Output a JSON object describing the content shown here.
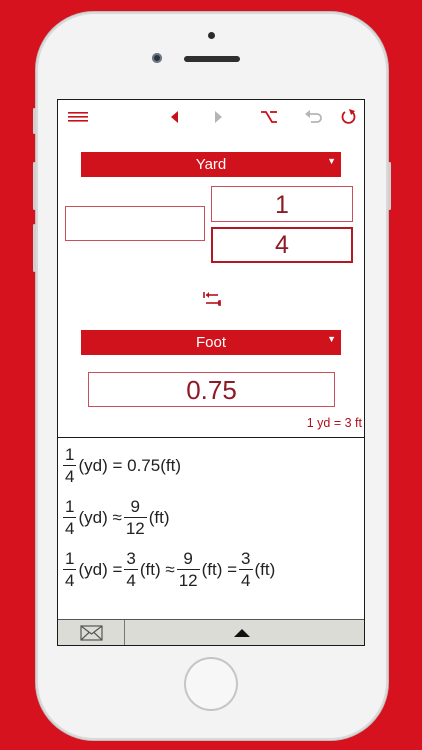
{
  "toolbar": {
    "menu_icon": "hamburger-icon",
    "back_icon": "triangle-left-icon",
    "forward_icon": "triangle-right-icon",
    "option_icon": "option-key-icon",
    "undo_icon": "undo-icon",
    "refresh_icon": "refresh-icon"
  },
  "from_unit": {
    "label": "Yard"
  },
  "input": {
    "whole": "",
    "numerator": "1",
    "denominator": "4"
  },
  "to_unit": {
    "label": "Foot"
  },
  "result": {
    "value": "0.75"
  },
  "ratio_text": "1 yd = 3 ft",
  "equations": {
    "line1": {
      "n1": "1",
      "d1": "4",
      "t1": "(yd) = 0.75(ft)"
    },
    "line2": {
      "n1": "1",
      "d1": "4",
      "t1": "(yd) ≈",
      "n2": "9",
      "d2": "12",
      "t2": "(ft)"
    },
    "line3": {
      "n1": "1",
      "d1": "4",
      "t1": "(yd) =",
      "n2": "3",
      "d2": "4",
      "t2": "(ft) ≈",
      "n3": "9",
      "d3": "12",
      "t3": "(ft) =",
      "n4": "3",
      "d4": "4",
      "t4": "(ft)"
    }
  },
  "colors": {
    "accent": "#d0121d",
    "background": "#d7121f",
    "number": "#8c1b25"
  }
}
